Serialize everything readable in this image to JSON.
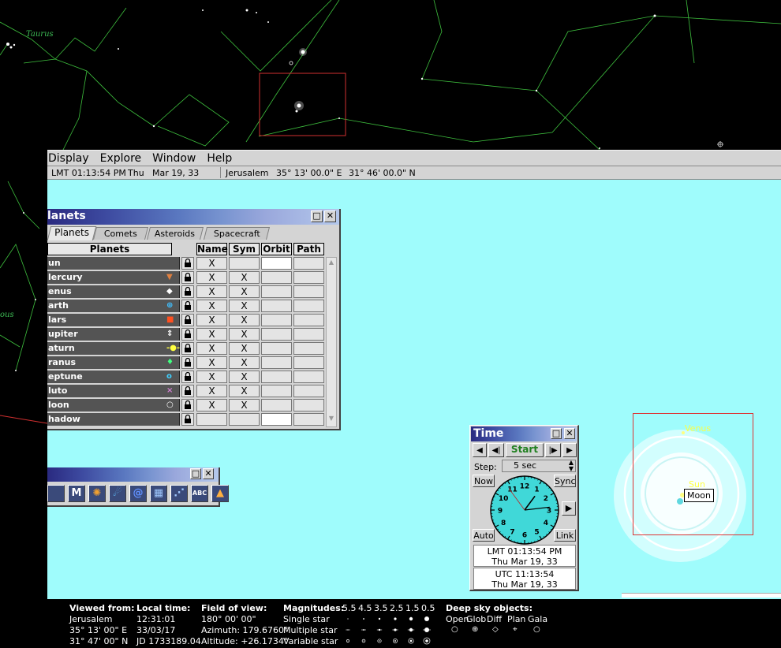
{
  "sky_labels": {
    "taurus": "Taurus",
    "left_fragment": "ous"
  },
  "menubar": {
    "items": [
      "Display",
      "Explore",
      "Window",
      "Help"
    ]
  },
  "statusline": {
    "time": "LMT 01:13:54 PM",
    "day": "Thu",
    "date": "Mar 19, 33",
    "location": "Jerusalem",
    "longitude": "35° 13' 00.0\" E",
    "latitude": "31° 46' 00.0\" N"
  },
  "planets_window": {
    "title": "lanets",
    "tabs": [
      "Planets",
      "Comets",
      "Asteroids",
      "Spacecraft"
    ],
    "columns": {
      "planets": "Planets",
      "name": "Name",
      "sym": "Sym",
      "orbit": "Orbit",
      "path": "Path"
    },
    "rows": [
      {
        "label": "un",
        "symbol": "",
        "symbol_color": "#ffffff",
        "name": "X",
        "sym": "",
        "orbit_white": true
      },
      {
        "label": "lercury",
        "symbol": "▼",
        "symbol_color": "#e08040",
        "name": "X",
        "sym": "X",
        "orbit_white": false
      },
      {
        "label": "enus",
        "symbol": "◆",
        "symbol_color": "#ffffff",
        "name": "X",
        "sym": "X",
        "orbit_white": false
      },
      {
        "label": "arth",
        "symbol": "⊕",
        "symbol_color": "#40c0ff",
        "name": "X",
        "sym": "X",
        "orbit_white": false
      },
      {
        "label": "lars",
        "symbol": "■",
        "symbol_color": "#ff5020",
        "name": "X",
        "sym": "X",
        "orbit_white": false
      },
      {
        "label": "upiter",
        "symbol": "⇕",
        "symbol_color": "#ffffff",
        "name": "X",
        "sym": "X",
        "orbit_white": false
      },
      {
        "label": "aturn",
        "symbol": "-●-",
        "symbol_color": "#ffff40",
        "name": "X",
        "sym": "X",
        "orbit_white": false
      },
      {
        "label": "ranus",
        "symbol": "♦",
        "symbol_color": "#40ff80",
        "name": "X",
        "sym": "X",
        "orbit_white": false
      },
      {
        "label": "eptune",
        "symbol": "o",
        "symbol_color": "#40d0ff",
        "name": "X",
        "sym": "X",
        "orbit_white": false
      },
      {
        "label": "luto",
        "symbol": "×",
        "symbol_color": "#d080d0",
        "name": "X",
        "sym": "X",
        "orbit_white": false
      },
      {
        "label": "loon",
        "symbol": "○",
        "symbol_color": "#ffffff",
        "name": "X",
        "sym": "X",
        "orbit_white": false
      },
      {
        "label": "hadow",
        "symbol": "",
        "symbol_color": "#ffffff",
        "name": "",
        "sym": "",
        "orbit_white": true
      }
    ]
  },
  "toolbar": {
    "buttons": [
      {
        "name": "stars-tool",
        "glyph": "",
        "color": "#c04040"
      },
      {
        "name": "messier-tool",
        "glyph": "M",
        "color": "#ffffff"
      },
      {
        "name": "sun-tool",
        "glyph": "✺",
        "color": "#f0a030"
      },
      {
        "name": "comet-tool",
        "glyph": "☄",
        "color": "#60c0ff"
      },
      {
        "name": "galaxy-tool",
        "glyph": "@",
        "color": "#6090ff"
      },
      {
        "name": "grid-tool",
        "glyph": "▦",
        "color": "#a0c8ff"
      },
      {
        "name": "horizon-tool",
        "glyph": "⋰",
        "color": "#a0c8ff"
      },
      {
        "name": "labels-tool",
        "glyph": "ABC",
        "color": "#ffffff"
      },
      {
        "name": "landscape-tool",
        "glyph": "▲",
        "color": "#ffb040"
      }
    ]
  },
  "time_window": {
    "title": "Time",
    "start_label": "Start",
    "step_label": "Step:",
    "step_value": "5 sec",
    "now_label": "Now",
    "sync_label": "Sync",
    "auto_label": "Auto",
    "link_label": "Link",
    "clock_numbers": [
      "12",
      "1",
      "2",
      "3",
      "4",
      "5",
      "6",
      "7",
      "8",
      "9",
      "10",
      "11"
    ],
    "clock_time": {
      "hour": 1,
      "minute": 13,
      "second": 54
    },
    "lmt_time": "LMT 01:13:54 PM",
    "lmt_date": "Thu Mar 19, 33",
    "utc_time": "UTC 11:13:54",
    "utc_date": "Thu Mar 19, 33"
  },
  "mini_view": {
    "venus": "Venus",
    "sun": "Sun",
    "moon": "Moon"
  },
  "infobar": {
    "viewed_from": {
      "label": "Viewed from:",
      "place": "Jerusalem",
      "lon": "35° 13' 00\" E",
      "lat": "31° 47' 00\" N"
    },
    "local_time": {
      "label": "Local time:",
      "time": "12:31:01",
      "date": "33/03/17",
      "jd": "JD 1733189.04"
    },
    "field_of_view": {
      "label": "Field of view:",
      "fov": "180° 00' 00\"",
      "azimuth": "Azimuth: 179.6760°",
      "altitude": "Altitude: +26.1734°"
    },
    "magnitudes": {
      "label": "Magnitudes:",
      "values": [
        "5.5",
        "4.5",
        "3.5",
        "2.5",
        "1.5",
        "0.5"
      ],
      "single": "Single star",
      "multiple": "Multiple star",
      "variable": "Variable star"
    },
    "deep_sky": {
      "label": "Deep sky objects:",
      "types": [
        "Open",
        "Glob",
        "Diff",
        "Plan",
        "Gala"
      ]
    }
  }
}
